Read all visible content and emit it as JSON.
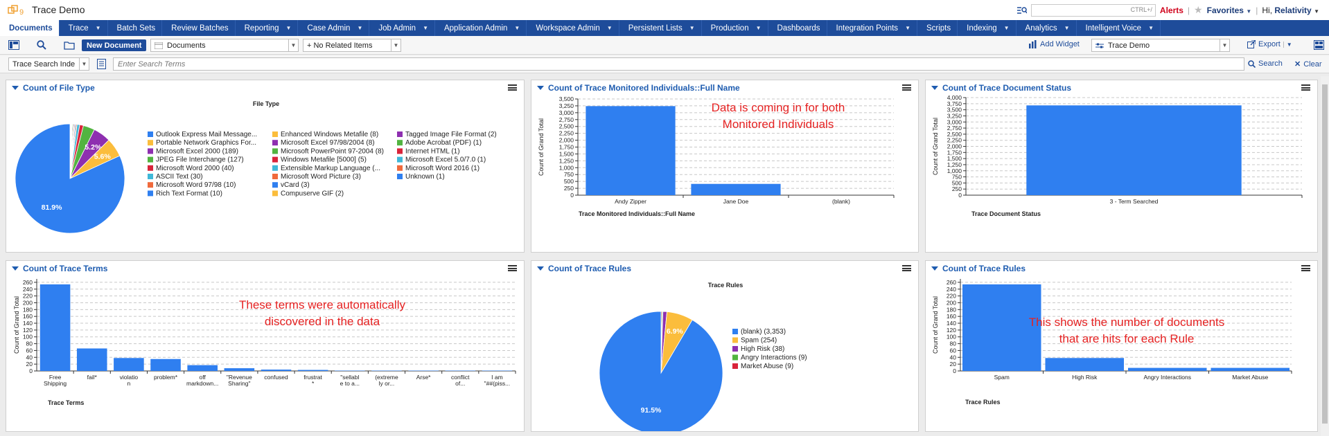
{
  "app": {
    "title": "Trace Demo",
    "search_hint": "CTRL+/",
    "alerts": "Alerts",
    "favorites": "Favorites",
    "greeting": "Hi,",
    "user": "Relativity"
  },
  "nav": {
    "tabs": [
      {
        "label": "Documents",
        "active": true,
        "dropdown": false
      },
      {
        "label": "Trace",
        "dropdown": true
      },
      {
        "label": "Batch Sets",
        "dropdown": false
      },
      {
        "label": "Review Batches",
        "dropdown": false
      },
      {
        "label": "Reporting",
        "dropdown": true
      },
      {
        "label": "Case Admin",
        "dropdown": true
      },
      {
        "label": "Job Admin",
        "dropdown": true
      },
      {
        "label": "Application Admin",
        "dropdown": true
      },
      {
        "label": "Workspace Admin",
        "dropdown": true
      },
      {
        "label": "Persistent Lists",
        "dropdown": true
      },
      {
        "label": "Production",
        "dropdown": true
      },
      {
        "label": "Dashboards",
        "dropdown": false
      },
      {
        "label": "Integration Points",
        "dropdown": true
      },
      {
        "label": "Scripts",
        "dropdown": false
      },
      {
        "label": "Indexing",
        "dropdown": true
      },
      {
        "label": "Analytics",
        "dropdown": true
      },
      {
        "label": "Intelligent Voice",
        "dropdown": true
      }
    ]
  },
  "toolbar": {
    "new_document": "New Document",
    "view_select": "Documents",
    "related_select": "+ No Related Items",
    "add_widget": "Add Widget",
    "dashboard_select": "Trace Demo",
    "export": "Export"
  },
  "search": {
    "index_select": "Trace Search Inde",
    "placeholder": "Enter Search Terms",
    "search_label": "Search",
    "clear_label": "Clear"
  },
  "panels": {
    "file_type": {
      "title": "Count of File Type"
    },
    "monitored": {
      "title": "Count of Trace Monitored Individuals::Full Name",
      "annotation": [
        "Data is coming in for both",
        "Monitored Individuals"
      ]
    },
    "doc_status": {
      "title": "Count of Trace Document Status"
    },
    "terms": {
      "title": "Count of Trace Terms",
      "annotation": [
        "These terms were automatically",
        "discovered in the data"
      ]
    },
    "rules_pie": {
      "title": "Count of Trace Rules"
    },
    "rules_bar": {
      "title": "Count of Trace Rules",
      "annotation": [
        "This shows the number of documents",
        "that are hits for each Rule"
      ]
    }
  },
  "colors": {
    "blue": "#2f7ff0",
    "orange": "#fbbd3c",
    "purple": "#8e2fb0",
    "green": "#52b440",
    "red": "#d9243a",
    "cyan": "#3fb8d8",
    "salmon": "#f06a3c",
    "annotation": "#e52222"
  },
  "chart_data": [
    {
      "id": "file_type",
      "type": "pie",
      "title": "File Type",
      "slices": [
        {
          "label": "Outlook Express Mail Message...",
          "value": 81.9,
          "color": "#2f7ff0",
          "pct_label": "81.9%"
        },
        {
          "label": "Portable Network Graphics For...",
          "value": 5.6,
          "color": "#fbbd3c",
          "pct_label": "5.6%"
        },
        {
          "label": "Microsoft Excel 2000 (189)",
          "value": 5.2,
          "color": "#8e2fb0",
          "pct_label": "5.2%"
        },
        {
          "label": "JPEG File Interchange (127)",
          "value": 3.4,
          "color": "#52b440"
        },
        {
          "label": "Microsoft Word 2000 (40)",
          "value": 1.1,
          "color": "#d9243a"
        },
        {
          "label": "ASCII Text (30)",
          "value": 0.8,
          "color": "#3fb8d8"
        },
        {
          "label": "Microsoft Word 97/98 (10)",
          "value": 0.3,
          "color": "#f06a3c"
        },
        {
          "label": "Rich Text Format (10)",
          "value": 0.3,
          "color": "#2f7ff0"
        },
        {
          "label": "Enhanced Windows Metafile (8)",
          "value": 0.25,
          "color": "#fbbd3c"
        },
        {
          "label": "Microsoft Excel 97/98/2004 (8)",
          "value": 0.25,
          "color": "#8e2fb0"
        },
        {
          "label": "Microsoft PowerPoint 97-2004 (8)",
          "value": 0.25,
          "color": "#52b440"
        },
        {
          "label": "Windows Metafile [5000] (5)",
          "value": 0.15,
          "color": "#d9243a"
        },
        {
          "label": "Extensible Markup Language (...",
          "value": 0.1,
          "color": "#3fb8d8"
        },
        {
          "label": "Microsoft Word Picture (3)",
          "value": 0.1,
          "color": "#f06a3c"
        },
        {
          "label": "vCard (3)",
          "value": 0.1,
          "color": "#2f7ff0"
        },
        {
          "label": "Compuserve GIF (2)",
          "value": 0.06,
          "color": "#fbbd3c"
        },
        {
          "label": "Tagged Image File Format (2)",
          "value": 0.06,
          "color": "#8e2fb0"
        },
        {
          "label": "Adobe Acrobat (PDF) (1)",
          "value": 0.03,
          "color": "#52b440"
        },
        {
          "label": "Internet HTML (1)",
          "value": 0.03,
          "color": "#d9243a"
        },
        {
          "label": "Microsoft Excel 5.0/7.0 (1)",
          "value": 0.03,
          "color": "#3fb8d8"
        },
        {
          "label": "Microsoft Word 2016 (1)",
          "value": 0.03,
          "color": "#f06a3c"
        },
        {
          "label": "Unknown (1)",
          "value": 0.03,
          "color": "#2f7ff0"
        }
      ]
    },
    {
      "id": "monitored",
      "type": "bar",
      "categories": [
        "Andy Zipper",
        "Jane Doe",
        "(blank)"
      ],
      "values": [
        3240,
        410,
        0
      ],
      "xlabel": "Trace Monitored Individuals::Full Name",
      "ylabel": "Count of Grand Total",
      "ylim": [
        0,
        3500
      ],
      "yticks": [
        0,
        250,
        500,
        750,
        1000,
        1250,
        1500,
        1750,
        2000,
        2250,
        2500,
        2750,
        3000,
        3250,
        3500
      ],
      "ytick_labels": [
        "0",
        "250",
        "500",
        "750",
        "1,000",
        "1,250",
        "1,500",
        "1,750",
        "2,000",
        "2,250",
        "2,500",
        "2,750",
        "3,000",
        "3,250",
        "3,500"
      ],
      "grid": true
    },
    {
      "id": "doc_status",
      "type": "bar",
      "categories": [
        "3 - Term Searched"
      ],
      "values": [
        3680
      ],
      "xlabel": "Trace Document Status",
      "ylabel": "Count of Grand Total",
      "ylim": [
        0,
        4000
      ],
      "yticks": [
        0,
        250,
        500,
        750,
        1000,
        1250,
        1500,
        1750,
        2000,
        2250,
        2500,
        2750,
        3000,
        3250,
        3500,
        3750,
        4000
      ],
      "ytick_labels": [
        "0",
        "250",
        "500",
        "750",
        "1,000",
        "1,250",
        "1,500",
        "1,750",
        "2,000",
        "2,250",
        "2,500",
        "2,750",
        "3,000",
        "3,250",
        "3,500",
        "3,750",
        "4,000"
      ],
      "grid": true
    },
    {
      "id": "terms",
      "type": "bar",
      "categories": [
        [
          "Free",
          "Shipping"
        ],
        [
          "fail*"
        ],
        [
          "violatio",
          "n"
        ],
        [
          "problem*"
        ],
        [
          "off",
          "markdown..."
        ],
        [
          "\"Revenue",
          "Sharing\""
        ],
        [
          "confused"
        ],
        [
          "frustrat",
          "*"
        ],
        [
          "\"sellabl",
          "e to a..."
        ],
        [
          "(extreme",
          "ly or..."
        ],
        [
          "Arse*"
        ],
        [
          "conflict",
          "of..."
        ],
        [
          "I am",
          "\"##(piss..."
        ]
      ],
      "values": [
        254,
        66,
        38,
        35,
        17,
        8,
        4,
        3,
        1,
        1,
        1,
        1,
        1
      ],
      "xlabel": "Trace Terms",
      "ylabel": "Count of Grand Total",
      "ylim": [
        0,
        270
      ],
      "yticks": [
        0,
        20,
        40,
        60,
        80,
        100,
        120,
        140,
        160,
        180,
        200,
        220,
        240,
        260
      ],
      "ytick_labels": [
        "0",
        "20",
        "40",
        "60",
        "80",
        "100",
        "120",
        "140",
        "160",
        "180",
        "200",
        "220",
        "240",
        "260"
      ],
      "grid": true
    },
    {
      "id": "rules_pie",
      "type": "pie",
      "title": "Trace Rules",
      "slices": [
        {
          "label": "(blank) (3,353)",
          "value": 3353,
          "color": "#2f7ff0",
          "pct_label": "91.5%"
        },
        {
          "label": "Spam (254)",
          "value": 254,
          "color": "#fbbd3c",
          "pct_label": "6.9%"
        },
        {
          "label": "High Risk (38)",
          "value": 38,
          "color": "#8e2fb0"
        },
        {
          "label": "Angry Interactions (9)",
          "value": 9,
          "color": "#52b440"
        },
        {
          "label": "Market Abuse (9)",
          "value": 9,
          "color": "#d9243a"
        }
      ]
    },
    {
      "id": "rules_bar",
      "type": "bar",
      "categories": [
        "Spam",
        "High Risk",
        "Angry Interactions",
        "Market Abuse"
      ],
      "values": [
        254,
        38,
        9,
        9
      ],
      "xlabel": "Trace Rules",
      "ylabel": "Count of Grand Total",
      "ylim": [
        0,
        270
      ],
      "yticks": [
        0,
        20,
        40,
        60,
        80,
        100,
        120,
        140,
        160,
        180,
        200,
        220,
        240,
        260
      ],
      "ytick_labels": [
        "0",
        "20",
        "40",
        "60",
        "80",
        "100",
        "120",
        "140",
        "160",
        "180",
        "200",
        "220",
        "240",
        "260"
      ],
      "grid": true
    }
  ]
}
